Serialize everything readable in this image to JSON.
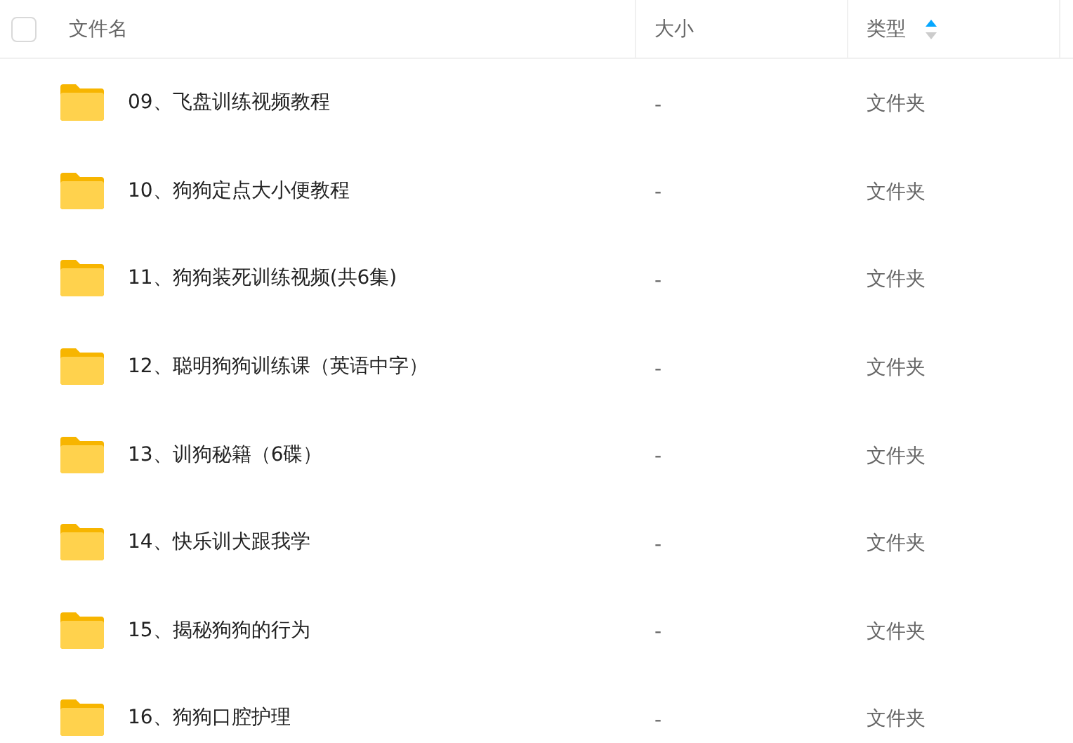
{
  "header": {
    "select_all": {
      "checked": false
    },
    "columns": [
      {
        "label": "文件名"
      },
      {
        "label": "大小"
      },
      {
        "label": "类型",
        "sort_ascending": true
      }
    ]
  },
  "rows": [
    {
      "name": "09、飞盘训练视频教程",
      "size": "-",
      "type": "文件夹"
    },
    {
      "name": "10、狗狗定点大小便教程",
      "size": "-",
      "type": "文件夹"
    },
    {
      "name": "11、狗狗装死训练视频(共6集)",
      "size": "-",
      "type": "文件夹"
    },
    {
      "name": "12、聪明狗狗训练课（英语中字）",
      "size": "-",
      "type": "文件夹"
    },
    {
      "name": "13、训狗秘籍（6碟）",
      "size": "-",
      "type": "文件夹"
    },
    {
      "name": "14、快乐训犬跟我学",
      "size": "-",
      "type": "文件夹"
    },
    {
      "name": "15、揭秘狗狗的行为",
      "size": "-",
      "type": "文件夹"
    },
    {
      "name": "16、狗狗口腔护理",
      "size": "-",
      "type": "文件夹"
    }
  ]
}
